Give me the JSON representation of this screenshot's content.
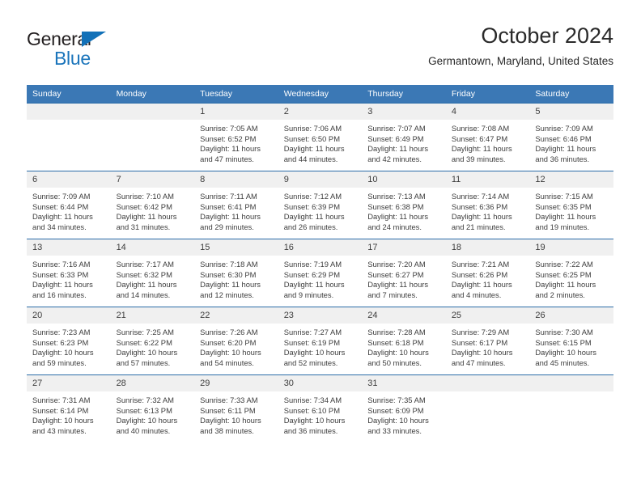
{
  "brand": {
    "name_part1": "General",
    "name_part2": "Blue",
    "triangle_color": "#1271b8",
    "blue_color": "#1b75bb"
  },
  "header": {
    "title": "October 2024",
    "subtitle": "Germantown, Maryland, United States"
  },
  "theme": {
    "header_blue": "#3b78b5",
    "rule_blue": "#2b6ca8",
    "daynum_band": "#f0f0f0",
    "text": "#3d3d3d"
  },
  "calendar": {
    "weekday_headers": [
      "Sunday",
      "Monday",
      "Tuesday",
      "Wednesday",
      "Thursday",
      "Friday",
      "Saturday"
    ],
    "weeks": [
      [
        {
          "day": "",
          "sunrise": "",
          "sunset": "",
          "daylight_line1": "",
          "daylight_line2": ""
        },
        {
          "day": "",
          "sunrise": "",
          "sunset": "",
          "daylight_line1": "",
          "daylight_line2": ""
        },
        {
          "day": "1",
          "sunrise": "Sunrise: 7:05 AM",
          "sunset": "Sunset: 6:52 PM",
          "daylight_line1": "Daylight: 11 hours",
          "daylight_line2": "and 47 minutes."
        },
        {
          "day": "2",
          "sunrise": "Sunrise: 7:06 AM",
          "sunset": "Sunset: 6:50 PM",
          "daylight_line1": "Daylight: 11 hours",
          "daylight_line2": "and 44 minutes."
        },
        {
          "day": "3",
          "sunrise": "Sunrise: 7:07 AM",
          "sunset": "Sunset: 6:49 PM",
          "daylight_line1": "Daylight: 11 hours",
          "daylight_line2": "and 42 minutes."
        },
        {
          "day": "4",
          "sunrise": "Sunrise: 7:08 AM",
          "sunset": "Sunset: 6:47 PM",
          "daylight_line1": "Daylight: 11 hours",
          "daylight_line2": "and 39 minutes."
        },
        {
          "day": "5",
          "sunrise": "Sunrise: 7:09 AM",
          "sunset": "Sunset: 6:46 PM",
          "daylight_line1": "Daylight: 11 hours",
          "daylight_line2": "and 36 minutes."
        }
      ],
      [
        {
          "day": "6",
          "sunrise": "Sunrise: 7:09 AM",
          "sunset": "Sunset: 6:44 PM",
          "daylight_line1": "Daylight: 11 hours",
          "daylight_line2": "and 34 minutes."
        },
        {
          "day": "7",
          "sunrise": "Sunrise: 7:10 AM",
          "sunset": "Sunset: 6:42 PM",
          "daylight_line1": "Daylight: 11 hours",
          "daylight_line2": "and 31 minutes."
        },
        {
          "day": "8",
          "sunrise": "Sunrise: 7:11 AM",
          "sunset": "Sunset: 6:41 PM",
          "daylight_line1": "Daylight: 11 hours",
          "daylight_line2": "and 29 minutes."
        },
        {
          "day": "9",
          "sunrise": "Sunrise: 7:12 AM",
          "sunset": "Sunset: 6:39 PM",
          "daylight_line1": "Daylight: 11 hours",
          "daylight_line2": "and 26 minutes."
        },
        {
          "day": "10",
          "sunrise": "Sunrise: 7:13 AM",
          "sunset": "Sunset: 6:38 PM",
          "daylight_line1": "Daylight: 11 hours",
          "daylight_line2": "and 24 minutes."
        },
        {
          "day": "11",
          "sunrise": "Sunrise: 7:14 AM",
          "sunset": "Sunset: 6:36 PM",
          "daylight_line1": "Daylight: 11 hours",
          "daylight_line2": "and 21 minutes."
        },
        {
          "day": "12",
          "sunrise": "Sunrise: 7:15 AM",
          "sunset": "Sunset: 6:35 PM",
          "daylight_line1": "Daylight: 11 hours",
          "daylight_line2": "and 19 minutes."
        }
      ],
      [
        {
          "day": "13",
          "sunrise": "Sunrise: 7:16 AM",
          "sunset": "Sunset: 6:33 PM",
          "daylight_line1": "Daylight: 11 hours",
          "daylight_line2": "and 16 minutes."
        },
        {
          "day": "14",
          "sunrise": "Sunrise: 7:17 AM",
          "sunset": "Sunset: 6:32 PM",
          "daylight_line1": "Daylight: 11 hours",
          "daylight_line2": "and 14 minutes."
        },
        {
          "day": "15",
          "sunrise": "Sunrise: 7:18 AM",
          "sunset": "Sunset: 6:30 PM",
          "daylight_line1": "Daylight: 11 hours",
          "daylight_line2": "and 12 minutes."
        },
        {
          "day": "16",
          "sunrise": "Sunrise: 7:19 AM",
          "sunset": "Sunset: 6:29 PM",
          "daylight_line1": "Daylight: 11 hours",
          "daylight_line2": "and 9 minutes."
        },
        {
          "day": "17",
          "sunrise": "Sunrise: 7:20 AM",
          "sunset": "Sunset: 6:27 PM",
          "daylight_line1": "Daylight: 11 hours",
          "daylight_line2": "and 7 minutes."
        },
        {
          "day": "18",
          "sunrise": "Sunrise: 7:21 AM",
          "sunset": "Sunset: 6:26 PM",
          "daylight_line1": "Daylight: 11 hours",
          "daylight_line2": "and 4 minutes."
        },
        {
          "day": "19",
          "sunrise": "Sunrise: 7:22 AM",
          "sunset": "Sunset: 6:25 PM",
          "daylight_line1": "Daylight: 11 hours",
          "daylight_line2": "and 2 minutes."
        }
      ],
      [
        {
          "day": "20",
          "sunrise": "Sunrise: 7:23 AM",
          "sunset": "Sunset: 6:23 PM",
          "daylight_line1": "Daylight: 10 hours",
          "daylight_line2": "and 59 minutes."
        },
        {
          "day": "21",
          "sunrise": "Sunrise: 7:25 AM",
          "sunset": "Sunset: 6:22 PM",
          "daylight_line1": "Daylight: 10 hours",
          "daylight_line2": "and 57 minutes."
        },
        {
          "day": "22",
          "sunrise": "Sunrise: 7:26 AM",
          "sunset": "Sunset: 6:20 PM",
          "daylight_line1": "Daylight: 10 hours",
          "daylight_line2": "and 54 minutes."
        },
        {
          "day": "23",
          "sunrise": "Sunrise: 7:27 AM",
          "sunset": "Sunset: 6:19 PM",
          "daylight_line1": "Daylight: 10 hours",
          "daylight_line2": "and 52 minutes."
        },
        {
          "day": "24",
          "sunrise": "Sunrise: 7:28 AM",
          "sunset": "Sunset: 6:18 PM",
          "daylight_line1": "Daylight: 10 hours",
          "daylight_line2": "and 50 minutes."
        },
        {
          "day": "25",
          "sunrise": "Sunrise: 7:29 AM",
          "sunset": "Sunset: 6:17 PM",
          "daylight_line1": "Daylight: 10 hours",
          "daylight_line2": "and 47 minutes."
        },
        {
          "day": "26",
          "sunrise": "Sunrise: 7:30 AM",
          "sunset": "Sunset: 6:15 PM",
          "daylight_line1": "Daylight: 10 hours",
          "daylight_line2": "and 45 minutes."
        }
      ],
      [
        {
          "day": "27",
          "sunrise": "Sunrise: 7:31 AM",
          "sunset": "Sunset: 6:14 PM",
          "daylight_line1": "Daylight: 10 hours",
          "daylight_line2": "and 43 minutes."
        },
        {
          "day": "28",
          "sunrise": "Sunrise: 7:32 AM",
          "sunset": "Sunset: 6:13 PM",
          "daylight_line1": "Daylight: 10 hours",
          "daylight_line2": "and 40 minutes."
        },
        {
          "day": "29",
          "sunrise": "Sunrise: 7:33 AM",
          "sunset": "Sunset: 6:11 PM",
          "daylight_line1": "Daylight: 10 hours",
          "daylight_line2": "and 38 minutes."
        },
        {
          "day": "30",
          "sunrise": "Sunrise: 7:34 AM",
          "sunset": "Sunset: 6:10 PM",
          "daylight_line1": "Daylight: 10 hours",
          "daylight_line2": "and 36 minutes."
        },
        {
          "day": "31",
          "sunrise": "Sunrise: 7:35 AM",
          "sunset": "Sunset: 6:09 PM",
          "daylight_line1": "Daylight: 10 hours",
          "daylight_line2": "and 33 minutes."
        },
        {
          "day": "",
          "sunrise": "",
          "sunset": "",
          "daylight_line1": "",
          "daylight_line2": ""
        },
        {
          "day": "",
          "sunrise": "",
          "sunset": "",
          "daylight_line1": "",
          "daylight_line2": ""
        }
      ]
    ]
  }
}
